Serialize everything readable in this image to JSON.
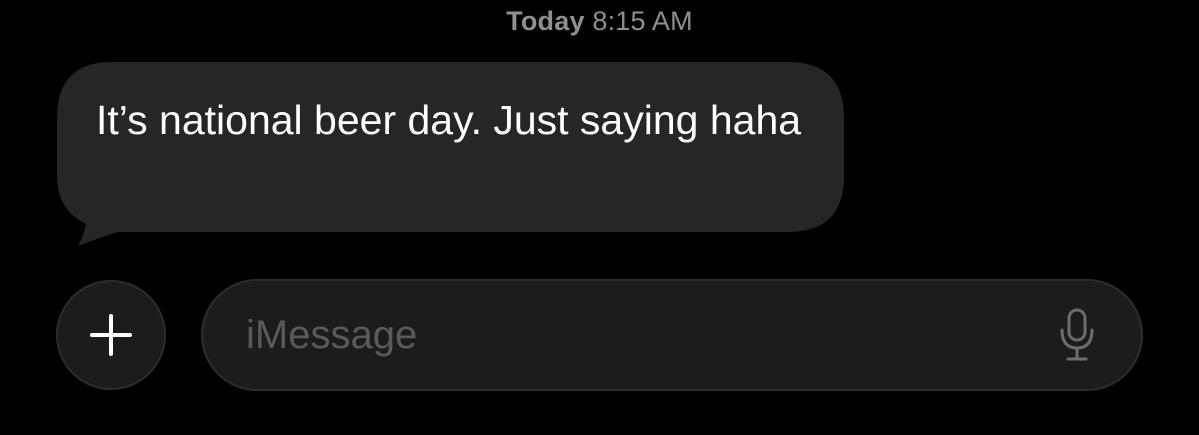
{
  "timestamp": {
    "day": "Today",
    "time": "8:15 AM"
  },
  "messages": [
    {
      "direction": "received",
      "text": "It’s national beer day. Just saying haha"
    }
  ],
  "composer": {
    "placeholder": "iMessage",
    "add_icon": "plus-icon",
    "mic_icon": "microphone-icon"
  },
  "colors": {
    "background": "#000000",
    "bubble_received": "#262628",
    "timestamp": "#8e8e93",
    "placeholder": "#5a5a5e"
  }
}
